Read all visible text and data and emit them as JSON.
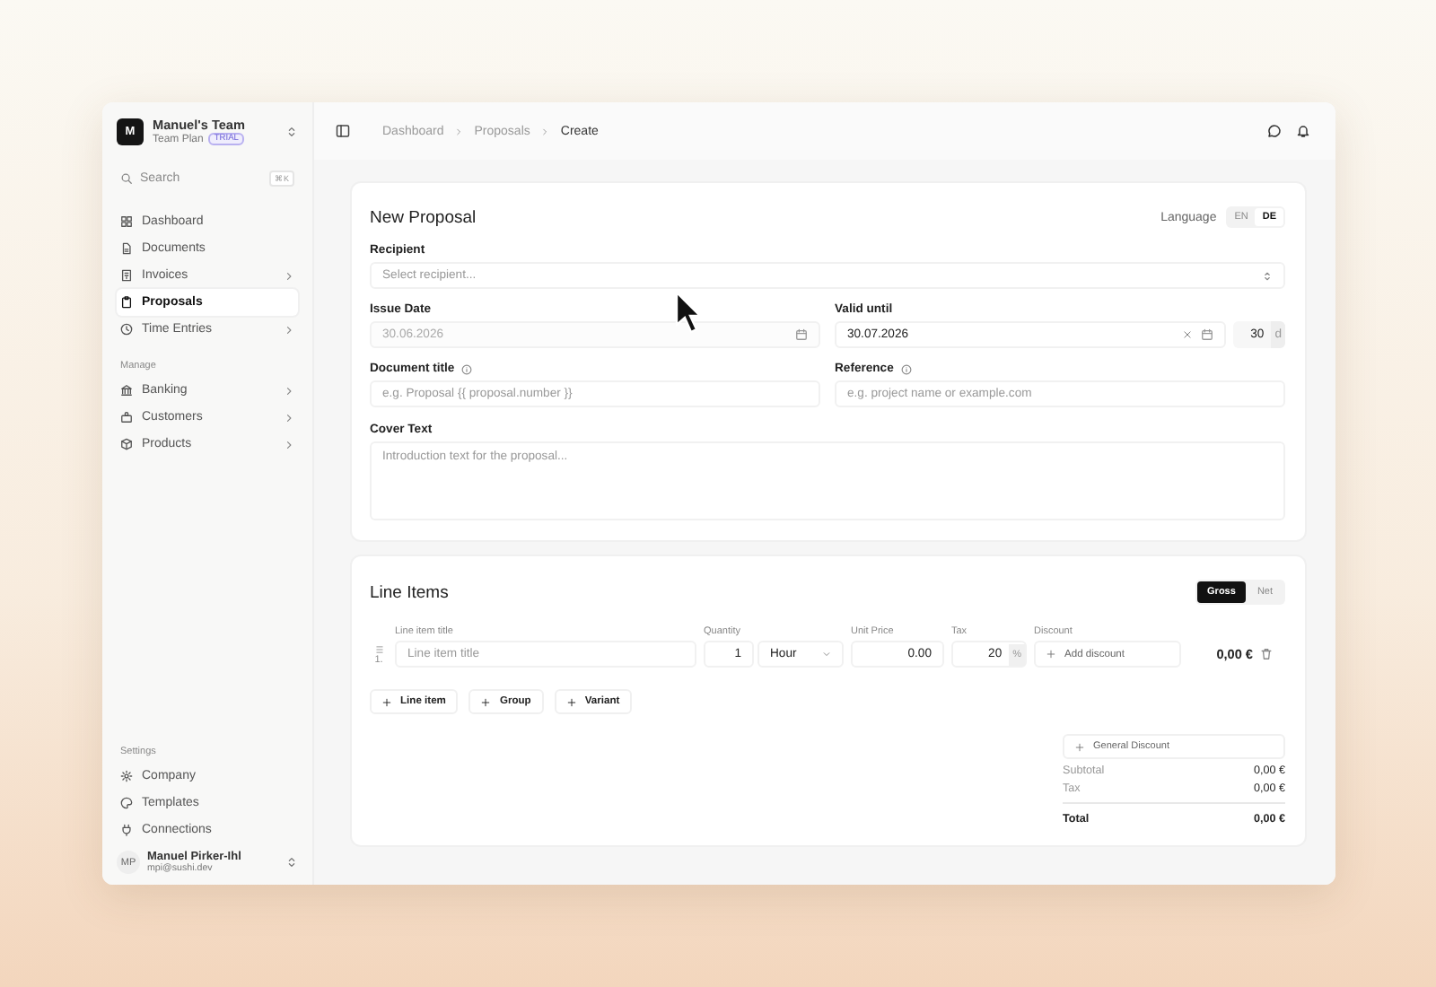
{
  "team": {
    "initials": "M",
    "name": "Manuel's Team",
    "plan": "Team Plan",
    "badge": "TRIAL"
  },
  "search": {
    "placeholder": "Search",
    "shortcut": "⌘K"
  },
  "nav": [
    {
      "items": [
        {
          "label": "Dashboard",
          "selected": false,
          "expandable": false
        },
        {
          "label": "Documents",
          "selected": false,
          "expandable": false
        },
        {
          "label": "Invoices",
          "selected": false,
          "expandable": true
        },
        {
          "label": "Proposals",
          "selected": true,
          "expandable": false
        },
        {
          "label": "Time Entries",
          "selected": false,
          "expandable": true
        }
      ]
    },
    {
      "title": "Manage",
      "items": [
        {
          "label": "Banking",
          "selected": false,
          "expandable": true
        },
        {
          "label": "Customers",
          "selected": false,
          "expandable": true
        },
        {
          "label": "Products",
          "selected": false,
          "expandable": true
        }
      ]
    }
  ],
  "settings": {
    "title": "Settings",
    "items": [
      {
        "label": "Company",
        "selected": false
      },
      {
        "label": "Templates",
        "selected": false
      },
      {
        "label": "Connections",
        "selected": false
      }
    ]
  },
  "user": {
    "initials": "MP",
    "name": "Manuel Pirker-Ihl",
    "email": "mpi@sushi.dev"
  },
  "breadcrumbs": [
    {
      "label": "Dashboard",
      "current": false
    },
    {
      "label": "Proposals",
      "current": false
    },
    {
      "label": "Create",
      "current": true
    }
  ],
  "proposal": {
    "title": "New Proposal",
    "language": {
      "label": "Language",
      "options": [
        {
          "label": "EN",
          "selected": false
        },
        {
          "label": "DE",
          "selected": true
        }
      ]
    },
    "recipient": {
      "label": "Recipient",
      "placeholder": "Select recipient..."
    },
    "issue_date": {
      "label": "Issue Date",
      "value": "30.06.2026",
      "disabled": true
    },
    "valid_until": {
      "label": "Valid until",
      "value": "30.07.2026",
      "days": "30",
      "unit": "d"
    },
    "document_title": {
      "label": "Document title",
      "placeholder": "e.g. Proposal {{ proposal.number }}"
    },
    "reference": {
      "label": "Reference",
      "placeholder": "e.g. project name or example.com"
    },
    "cover_text": {
      "label": "Cover Text",
      "placeholder": "Introduction text for the proposal..."
    }
  },
  "line_items": {
    "title": "Line Items",
    "price_modes": [
      {
        "label": "Gross",
        "selected": true
      },
      {
        "label": "Net",
        "selected": false
      }
    ],
    "columns": [
      "Line item title",
      "Quantity",
      "Unit Price",
      "Tax",
      "Discount"
    ],
    "rows": [
      {
        "number": "1.",
        "title_placeholder": "Line item title",
        "quantity": "1",
        "unit": "Hour",
        "unit_price": "0.00",
        "tax": "20",
        "tax_unit": "%",
        "discount": "Add discount",
        "total": "0,00 €"
      }
    ],
    "add_buttons": [
      "Line item",
      "Group",
      "Variant"
    ],
    "general_discount": "General Discount",
    "summary": [
      {
        "label": "Subtotal",
        "value": "0,00 €",
        "kind": "sub"
      },
      {
        "label": "Tax",
        "value": "0,00 €",
        "kind": "sub"
      },
      {
        "label": "Total",
        "value": "0,00 €",
        "kind": "total"
      }
    ]
  }
}
